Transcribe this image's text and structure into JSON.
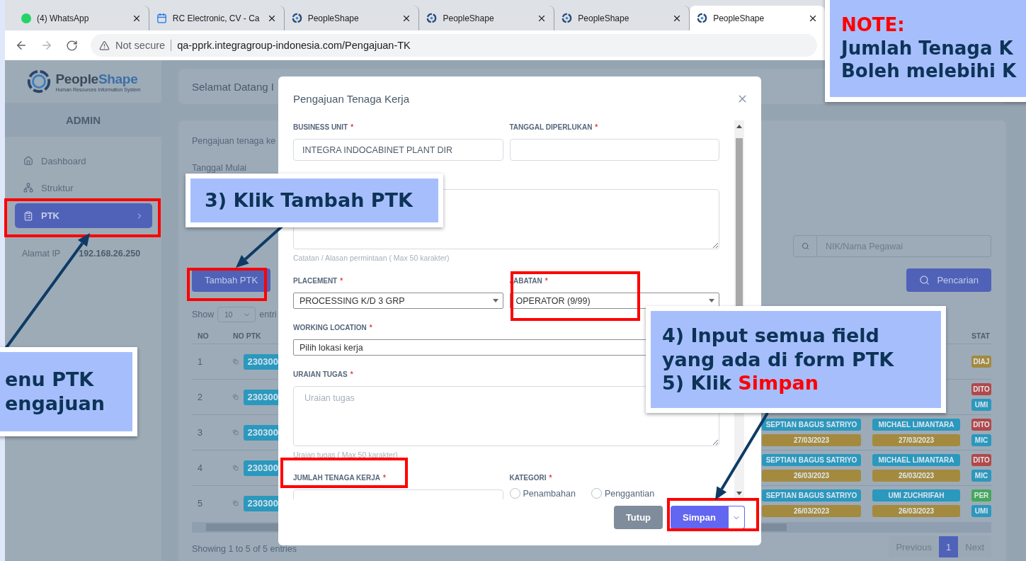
{
  "browser": {
    "tabs": [
      {
        "title": "(4) WhatsApp",
        "kind": "chat",
        "selected": false
      },
      {
        "title": "RC Electronic, CV - Ca",
        "kind": "calendar",
        "selected": false
      },
      {
        "title": "PeopleShape",
        "kind": "app",
        "selected": false
      },
      {
        "title": "PeopleShape",
        "kind": "app",
        "selected": false
      },
      {
        "title": "PeopleShape",
        "kind": "app",
        "selected": false
      },
      {
        "title": "PeopleShape",
        "kind": "app",
        "selected": true
      }
    ],
    "security": "Not secure",
    "url": "qa-pprk.integragroup-indonesia.com/Pengajuan-TK"
  },
  "sidebar": {
    "logo": {
      "parts": [
        "People",
        "Shape"
      ],
      "tagline": "Human Resources Information System"
    },
    "role": "ADMIN",
    "items": [
      {
        "label": "Dashboard",
        "kind": "home",
        "selected": false
      },
      {
        "label": "Struktur",
        "kind": "tree",
        "selected": false
      },
      {
        "label": "PTK",
        "kind": "form",
        "selected": true
      }
    ],
    "ip_label": "Alamat IP",
    "ip": "192.168.26.250"
  },
  "main": {
    "greeting": "Selamat Datang I",
    "intro": "Pengajuan tenaga ke",
    "date_label": "Tanggal Mulai",
    "search_placeholder": "NIK/Nama Pegawai",
    "search_button": "Pencarian",
    "add_button": "Tambah PTK",
    "show_label": "Show",
    "page_size": "10",
    "entries_label": "entri",
    "table": {
      "columns": [
        "NO",
        "NO PTK",
        "STAT"
      ],
      "rows": [
        {
          "no": "1",
          "ptk": "230300",
          "col_a": [],
          "col_b": [],
          "status": [
            {
              "text": "DIAJ",
              "color": "#a48a3e"
            }
          ]
        },
        {
          "no": "2",
          "ptk": "230300",
          "col_a": [],
          "col_b": [],
          "status": [
            {
              "text": "DITO",
              "color": "#b24848"
            },
            {
              "text": "UMI",
              "color": "#2b98bd"
            }
          ]
        },
        {
          "no": "3",
          "ptk": "230300",
          "col_a": [
            {
              "text": "SEPTIAN BAGUS SATRIYO",
              "color": "#2b98bd"
            },
            {
              "text": "27/03/2023",
              "color": "#a48a3e"
            }
          ],
          "col_b": [
            {
              "text": "MICHAEL LIMANTARA",
              "color": "#2b98bd"
            },
            {
              "text": "27/03/2023",
              "color": "#a48a3e"
            }
          ],
          "status": [
            {
              "text": "DITO",
              "color": "#b24848"
            },
            {
              "text": "MIC",
              "color": "#2b98bd"
            }
          ]
        },
        {
          "no": "4",
          "ptk": "230300",
          "col_a": [
            {
              "text": "SEPTIAN BAGUS SATRIYO",
              "color": "#2b98bd"
            },
            {
              "text": "26/03/2023",
              "color": "#a48a3e"
            }
          ],
          "col_b": [
            {
              "text": "MICHAEL LIMANTARA",
              "color": "#2b98bd"
            },
            {
              "text": "26/03/2023",
              "color": "#a48a3e"
            }
          ],
          "status": [
            {
              "text": "DITO",
              "color": "#b24848"
            },
            {
              "text": "MIC",
              "color": "#2b98bd"
            }
          ]
        },
        {
          "no": "5",
          "ptk": "230300",
          "col_a": [
            {
              "text": "SEPTIAN BAGUS SATRIYO",
              "color": "#2b98bd"
            },
            {
              "text": "26/03/2023",
              "color": "#a48a3e"
            }
          ],
          "col_b": [
            {
              "text": "UMI ZUCHRIFAH",
              "color": "#2b98bd"
            },
            {
              "text": "26/03/2023",
              "color": "#a48a3e"
            }
          ],
          "status": [
            {
              "text": "PER",
              "color": "#45a85a"
            },
            {
              "text": "UMI",
              "color": "#2b98bd"
            }
          ]
        }
      ]
    },
    "info": "Showing 1 to 5 of 5 entries",
    "pagination": [
      {
        "label": "Previous",
        "selected": false
      },
      {
        "label": "1",
        "selected": true
      },
      {
        "label": "Next",
        "selected": false
      }
    ]
  },
  "modal": {
    "title": "Pengajuan Tenaga Kerja",
    "rows": [
      [
        {
          "kind": "input",
          "label": "BUSINESS UNIT",
          "required_mark": "*",
          "value": "INTEGRA INDOCABINET PLANT DIR"
        },
        {
          "kind": "input",
          "label": "TANGGAL DIPERLUKAN",
          "required_mark": "*"
        }
      ],
      [
        {
          "kind": "textarea",
          "hint": "Catatan / Alasan permintaan ( Max 50 karakter)"
        }
      ],
      [
        {
          "kind": "select",
          "label": "PLACEMENT",
          "required_mark": "*",
          "value": "PROCESSING K/D 3 GRP"
        },
        {
          "kind": "select",
          "label": "JABATAN",
          "required_mark": "*",
          "value": "OPERATOR (9/99)"
        }
      ],
      [
        {
          "kind": "select",
          "label": "WORKING LOCATION",
          "required_mark": "*",
          "value": "Pilih lokasi kerja"
        }
      ],
      [
        {
          "kind": "textarea",
          "label": "URAIAN TUGAS",
          "required_mark": "*",
          "placeholder": "Uraian tugas",
          "hint": "Uraian tugas ( Max 50 karakter)"
        }
      ],
      [
        {
          "kind": "input",
          "label": "JUMLAH TENAGA KERJA",
          "required_mark": "*"
        },
        {
          "kind": "radio",
          "label": "KATEGORI",
          "required_mark": "*",
          "options": [
            {
              "label": "Penambahan",
              "selected": false
            },
            {
              "label": "Penggantian",
              "selected": false
            }
          ]
        }
      ]
    ],
    "buttons": [
      {
        "label": "Tutup",
        "kind": "secondary"
      },
      {
        "label": "Simpan",
        "kind": "primary"
      }
    ]
  },
  "callouts": [
    {
      "lines": [
        [
          {
            "text": "enu PTK",
            "highlight": false
          }
        ],
        [
          {
            "text": "engajuan",
            "highlight": false
          }
        ]
      ]
    },
    {
      "lines": [
        [
          {
            "text": "3) Klik Tambah PTK",
            "highlight": false
          }
        ]
      ]
    },
    {
      "lines": [
        [
          {
            "text": "4) Input semua field",
            "highlight": false
          }
        ],
        [
          {
            "text": "yang ada di form PTK",
            "highlight": false
          }
        ],
        [
          {
            "text": "5) Klik ",
            "highlight": false
          },
          {
            "text": "Simpan",
            "highlight": true
          }
        ]
      ]
    },
    {
      "lines": [
        [
          {
            "text": "NOTE:",
            "highlight": true
          }
        ],
        [
          {
            "text": "Jumlah Tenaga K",
            "highlight": false
          }
        ],
        [
          {
            "text": "Boleh melebihi K",
            "highlight": false
          }
        ]
      ]
    }
  ]
}
